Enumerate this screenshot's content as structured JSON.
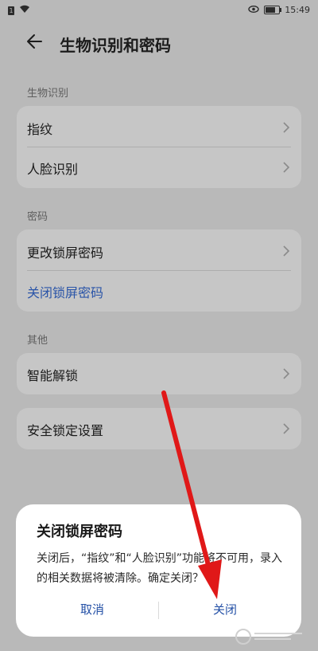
{
  "status_bar": {
    "time": "15:49",
    "sim_badge": "1"
  },
  "header": {
    "title": "生物识别和密码"
  },
  "sections": {
    "biometrics": {
      "label": "生物识别",
      "items": [
        "指纹",
        "人脸识别"
      ]
    },
    "password": {
      "label": "密码",
      "items": [
        "更改锁屏密码",
        "关闭锁屏密码"
      ]
    },
    "other": {
      "label": "其他",
      "items": [
        "智能解锁",
        "安全锁定设置"
      ]
    }
  },
  "dialog": {
    "title": "关闭锁屏密码",
    "message": "关闭后，“指纹”和“人脸识别”功能将不可用，录入的相关数据将被清除。确定关闭？",
    "cancel_label": "取消",
    "confirm_label": "关闭"
  },
  "battery": {
    "level_fraction": 0.8
  },
  "colors": {
    "accent": "#2450a6",
    "annotation_arrow": "#e01818"
  }
}
